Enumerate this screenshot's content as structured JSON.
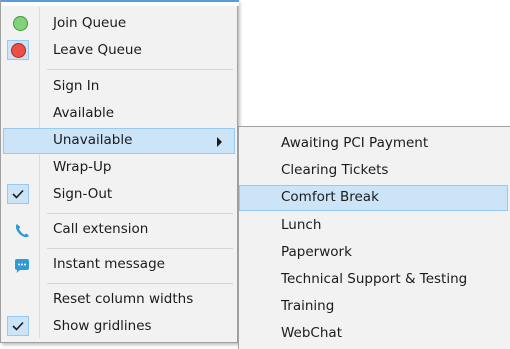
{
  "main_menu": {
    "join_queue": "Join Queue",
    "leave_queue": "Leave Queue",
    "sign_in": "Sign In",
    "available": "Available",
    "unavailable": "Unavailable",
    "wrap_up": "Wrap-Up",
    "sign_out": "Sign-Out",
    "call_extension": "Call extension",
    "instant_message": "Instant message",
    "reset_column_widths": "Reset column widths",
    "show_gridlines": "Show gridlines"
  },
  "submenu": {
    "items": [
      "Awaiting PCI Payment",
      "Clearing Tickets",
      "Comfort Break",
      "Lunch",
      "Paperwork",
      "Technical Support & Testing",
      "Training",
      "WebChat"
    ],
    "highlighted": "Comfort Break"
  },
  "checked": {
    "sign_out": true,
    "show_gridlines": true
  },
  "colors": {
    "highlight": "#cce4f7",
    "highlight_border": "#99c9ef",
    "join_icon": "#7fd47a",
    "leave_icon": "#ea4f48",
    "phone_icon": "#2f9bd6",
    "chat_icon": "#2f9bd6"
  }
}
